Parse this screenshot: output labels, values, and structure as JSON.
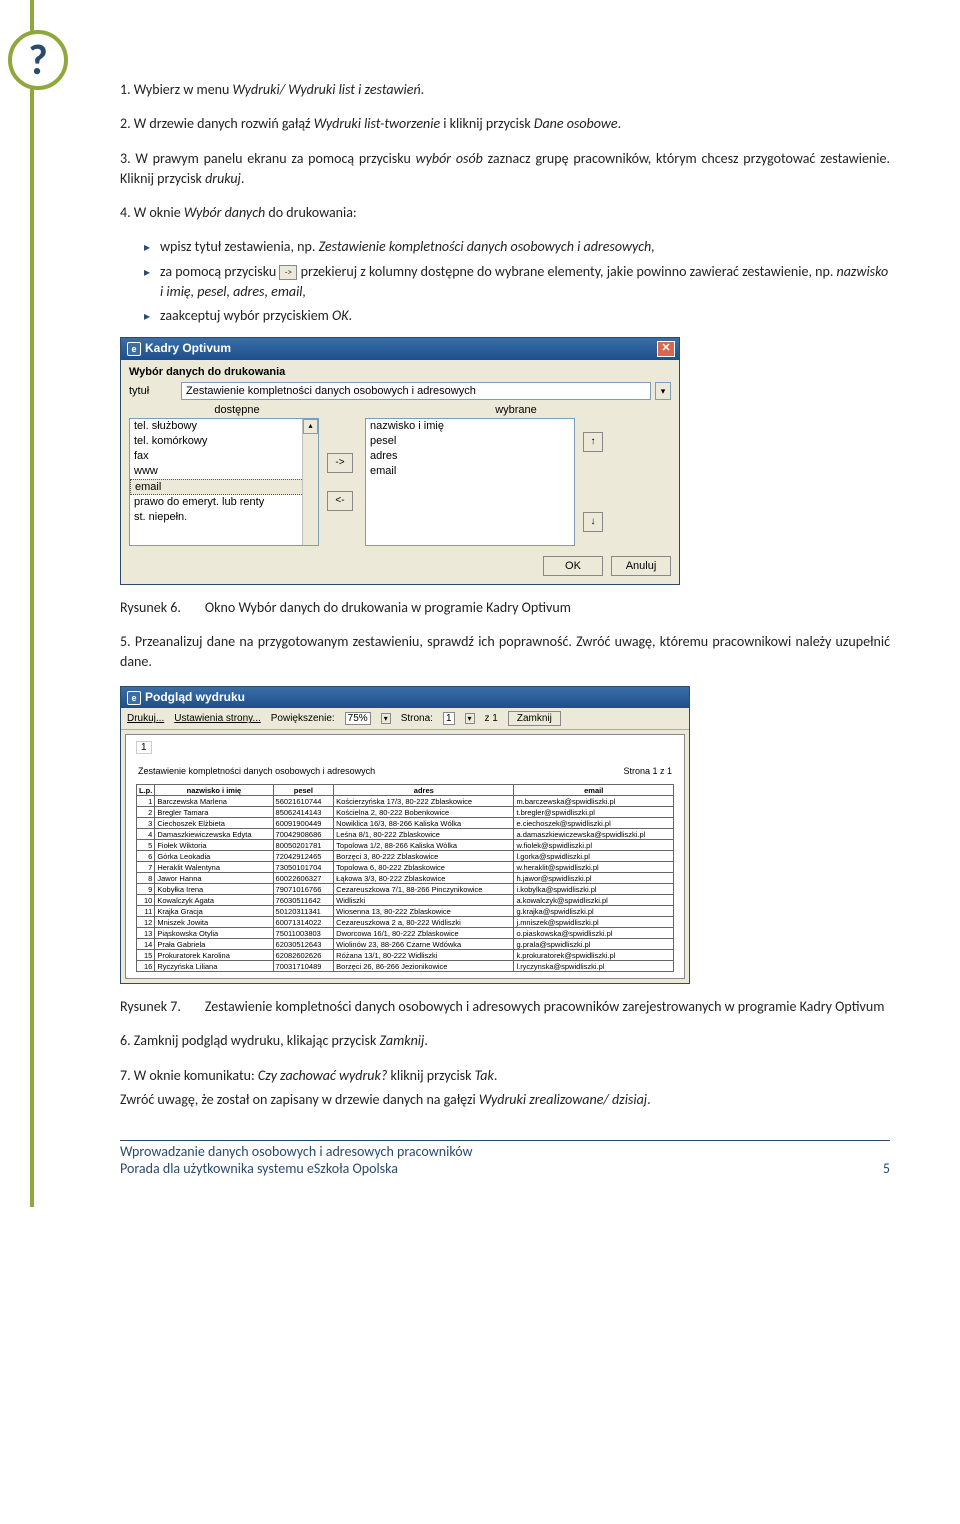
{
  "qmark": "?",
  "steps": {
    "s1a": "1.  Wybierz w menu ",
    "s1b": "Wydruki/ Wydruki list i zestawień",
    "s1c": ".",
    "s2a": "2.  W drzewie danych rozwiń gałąź ",
    "s2b": "Wydruki list-tworzenie",
    "s2c": " i kliknij przycisk ",
    "s2d": "Dane osobowe",
    "s2e": ".",
    "s3a": "3.  W prawym panelu ekranu za pomocą przycisku ",
    "s3b": "wybór osób",
    "s3c": " zaznacz grupę pracowników, którym chcesz przygotować zestawienie. Kliknij przycisk ",
    "s3d": "drukuj",
    "s3e": ".",
    "s4a": "4.  W oknie ",
    "s4b": "Wybór danych",
    "s4c": " do drukowania:"
  },
  "bullets": {
    "b1a": "wpisz tytuł zestawienia, np. ",
    "b1b": "Zestawienie kompletności danych osobowych i adresowych,",
    "b2a": "za pomocą przycisku ",
    "b2b": "przekieruj z kolumny dostępne do wybrane elementy, jakie powinno zawierać zestawienie, np. ",
    "b2c": "nazwisko i imię, pesel, adres, email,",
    "b3a": "zaakceptuj wybór przyciskiem ",
    "b3b": "OK",
    "b3c": "."
  },
  "win1": {
    "title": "Kadry Optivum",
    "heading": "Wybór danych do drukowania",
    "lbl_tytul": "tytuł",
    "tytul_val": "Zestawienie kompletności danych osobowych i adresowych",
    "col_left": "dostępne",
    "col_right": "wybrane",
    "left_items": [
      "tel. służbowy",
      "tel. komórkowy",
      "fax",
      "www",
      "email",
      "prawo do emeryt. lub renty",
      "st. niepełn."
    ],
    "right_items": [
      "nazwisko i imię",
      "pesel",
      "adres",
      "email"
    ],
    "btn_right": "->",
    "btn_left": "<-",
    "btn_up": "↑",
    "btn_down": "↓",
    "btn_ok": "OK",
    "btn_cancel": "Anuluj"
  },
  "caption1": {
    "lbl": "Rysunek 6.",
    "txt": "Okno Wybór danych do drukowania w programie Kadry Optivum"
  },
  "step5": "5.  Przeanalizuj dane na przygotowanym zestawieniu, sprawdź ich poprawność. Zwróć uwagę, któremu pracownikowi należy uzupełnić dane.",
  "win2": {
    "title": "Podgląd wydruku",
    "tb_drukuj": "Drukuj...",
    "tb_ust": "Ustawienia strony...",
    "tb_pow": "Powiększenie:",
    "tb_zoom": "75%",
    "tb_strona": "Strona:",
    "tb_strona_n": "1",
    "tb_z": "z  1",
    "tb_zamknij": "Zamknij",
    "pv_num": "1",
    "pv_title": "Zestawienie kompletności danych osobowych i adresowych",
    "pv_page": "Strona 1 z 1",
    "headers": [
      "L.p.",
      "nazwisko i imię",
      "pesel",
      "adres",
      "email"
    ],
    "rows": [
      [
        "1",
        "Barczewska Marlena",
        "56021610744",
        "Kościerzyńska 17/3, 80-222 Zblaskowice",
        "m.barczewska@spwidliszki.pl"
      ],
      [
        "2",
        "Bregler Tamara",
        "85062414143",
        "Kościelna 2, 80-222 Bobenkowice",
        "t.bregler@spwidliszki.pl"
      ],
      [
        "3",
        "Ciechoszek Elżbieta",
        "60091900449",
        "Nowiklica 16/3, 88-266 Kaliska Wólka",
        "e.ciechoszek@spwidliszki.pl"
      ],
      [
        "4",
        "Damaszkiewiczewska Edyta",
        "70042908686",
        "Leśna 8/1, 80-222 Zblaskowice",
        "a.damaszkiewiczewska@spwidliszki.pl"
      ],
      [
        "5",
        "Fiołek Wiktoria",
        "80050201781",
        "Topolowa 1/2, 88-266 Kaliska Wólka",
        "w.fiolek@spwidliszki.pl"
      ],
      [
        "6",
        "Górka Leokadia",
        "72042912465",
        "Borzęci 3, 80-222 Zblaskowice",
        "l.gorka@spwidliszki.pl"
      ],
      [
        "7",
        "Heraklit Walentyna",
        "73050101704",
        "Topolowa 6, 80-222 Zblaskowice",
        "w.heraklit@spwidliszki.pl"
      ],
      [
        "8",
        "Jawor Hanna",
        "60022606327",
        "Łąkowa 3/3, 80-222 Zblaskowice",
        "h.jawor@spwidliszki.pl"
      ],
      [
        "9",
        "Kobyłka Irena",
        "79071016766",
        "Cezareuszkowa 7/1, 88-266 Pinczynikowice",
        "i.kobylka@spwidliszki.pl"
      ],
      [
        "10",
        "Kowalczyk Agata",
        "76030511642",
        "Widliszki",
        "a.kowalczyk@spwidliszki.pl"
      ],
      [
        "11",
        "Krajka Gracja",
        "50120311341",
        "Wiosenna 13, 80-222 Zblaskowice",
        "g.krajka@spwidliszki.pl"
      ],
      [
        "12",
        "Mniszek Jowita",
        "60071314022",
        "Cezareuszkowa 2 a, 80-222 Widliszki",
        "j.mniszek@spwidliszki.pl"
      ],
      [
        "13",
        "Piąskowska Otylia",
        "75011003803",
        "Dworcowa 16/1, 80-222 Zblaskowice",
        "o.piaskowska@spwidliszki.pl"
      ],
      [
        "14",
        "Prała Gabriela",
        "62030512643",
        "Wiolinów 23, 88-266 Czarne Wdówka",
        "g.prala@spwidliszki.pl"
      ],
      [
        "15",
        "Prokuratorek Karolina",
        "62082602626",
        "Różana 13/1, 80-222 Widliszki",
        "k.prokuratorek@spwidliszki.pl"
      ],
      [
        "16",
        "Ryczyńska Liliana",
        "70031710489",
        "Borzęci 26, 86-266 Jezionikowice",
        "l.ryczynska@spwidliszki.pl"
      ]
    ]
  },
  "caption2": {
    "lbl": "Rysunek 7.",
    "txt": "Zestawienie kompletności danych osobowych i adresowych pracowników zarejestrowanych w programie Kadry Optivum"
  },
  "step6a": "6.  Zamknij podgląd wydruku, klikając przycisk ",
  "step6b": "Zamknij",
  "step6c": ".",
  "step7a": "7.  W oknie komunikatu: ",
  "step7b": "Czy zachować wydruk?",
  "step7c": " kliknij przycisk ",
  "step7d": "Tak",
  "step7e": ".",
  "step7_note_a": "Zwróć uwagę, że został on zapisany w drzewie danych na gałęzi ",
  "step7_note_b": "Wydruki zrealizowane/ dzisiaj",
  "step7_note_c": ".",
  "footer": {
    "line1": "Wprowadzanie danych osobowych i adresowych pracowników",
    "line2": "Porada dla użytkownika systemu eSzkoła Opolska",
    "page": "5"
  }
}
